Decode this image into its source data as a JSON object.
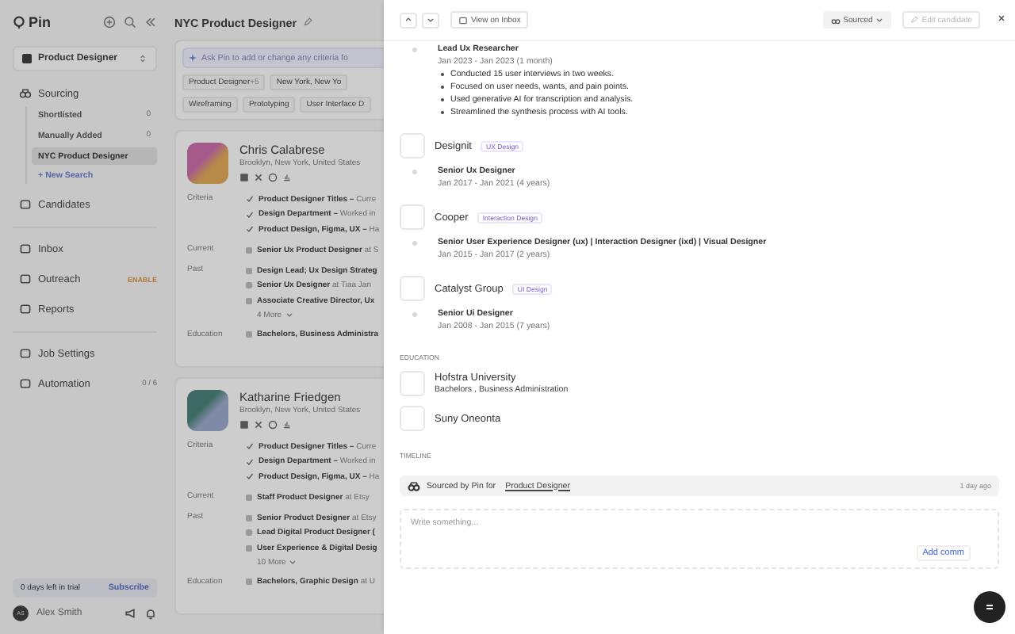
{
  "sidebar": {
    "brand": "Pin",
    "project": "Product Designer",
    "sourcing": {
      "label": "Sourcing",
      "searches": [
        {
          "label": "Shortlisted",
          "count": "0",
          "selected": false
        },
        {
          "label": "Manually Added",
          "count": "0",
          "selected": false
        },
        {
          "label": "NYC Product Designer",
          "selected": true
        }
      ],
      "new_search": "+ New Search"
    },
    "groups": [
      [
        {
          "label": "Candidates"
        }
      ],
      [
        {
          "label": "Inbox"
        },
        {
          "label": "Outreach",
          "badge": "ENABLE"
        },
        {
          "label": "Reports"
        }
      ],
      [
        {
          "label": "Job Settings"
        },
        {
          "label": "Automation",
          "count": "0 / 6"
        }
      ]
    ],
    "trial": {
      "text": "0 days left in trial",
      "action": "Subscribe"
    },
    "user": {
      "initials": "AS",
      "name": "Alex Smith"
    }
  },
  "main": {
    "title": "NYC Product Designer",
    "ask_placeholder": "Ask Pin to add or change any criteria fo",
    "filters": [
      {
        "label": "Product Designer",
        "extra": "+5"
      },
      {
        "label": "New York, New Yo"
      }
    ],
    "skills": [
      "Wireframing",
      "Prototyping",
      "User Interface D"
    ],
    "candidates": [
      {
        "name": "Chris Calabrese",
        "location": "Brooklyn, New York, United States",
        "labels": {
          "criteria": "Criteria",
          "current": "Current",
          "past": "Past",
          "education": "Education"
        },
        "criteria": [
          {
            "title": "Product Designer Titles –",
            "detail": "Curre"
          },
          {
            "title": "Design Department –",
            "detail": "Worked in"
          },
          {
            "title": "Product Design, Figma, UX –",
            "detail": "Ha"
          }
        ],
        "current": [
          {
            "role": "Senior Ux Product Designer",
            "detail": "at S"
          }
        ],
        "past": [
          {
            "role": "Design Lead; Ux Design Strateg"
          },
          {
            "role": "Senior Ux Designer",
            "detail": "at Tiaa  Jan"
          },
          {
            "role": "Associate Creative Director, Ux"
          }
        ],
        "more": "4 More",
        "education": {
          "role": "Bachelors, Business Administra"
        }
      },
      {
        "name": "Katharine Friedgen",
        "location": "Brooklyn, New York, United States",
        "labels": {
          "criteria": "Criteria",
          "current": "Current",
          "past": "Past",
          "education": "Education"
        },
        "criteria": [
          {
            "title": "Product Designer Titles –",
            "detail": "Curre"
          },
          {
            "title": "Design Department –",
            "detail": "Worked in"
          },
          {
            "title": "Product Design, Figma, UX –",
            "detail": "Ha"
          }
        ],
        "current": [
          {
            "role": "Staff Product Designer",
            "detail": "at Etsy"
          }
        ],
        "past": [
          {
            "role": "Senior Product Designer",
            "detail": "at Etsy"
          },
          {
            "role": "Lead Digital Product Designer ("
          },
          {
            "role": "User Experience & Digital Desig"
          }
        ],
        "more": "10 More",
        "education": {
          "role": "Bachelors, Graphic Design",
          "detail": "at U"
        }
      }
    ]
  },
  "drawer": {
    "toolbar": {
      "view_inbox": "View on Inbox",
      "status": "Sourced",
      "edit": {
        "label": "Edit candidate",
        "disabled": true
      }
    },
    "first_role": {
      "title": "Lead Ux Researcher",
      "dates": "Jan 2023 - Jan 2023 (1 month)",
      "bullets": [
        "Conducted 15 user interviews in two weeks.",
        "Focused on user needs, wants, and pain points.",
        "Used generative AI for transcription and analysis.",
        "Streamlined the synthesis process with AI tools."
      ]
    },
    "companies": [
      {
        "name": "Designit",
        "tag": "UX Design",
        "roles": [
          {
            "title": "Senior Ux Designer",
            "dates": "Jan 2017 - Jan 2021 (4 years)"
          }
        ]
      },
      {
        "name": "Cooper",
        "tag": "Interaction Design",
        "roles": [
          {
            "title": "Senior User Experience Designer (ux) | Interaction Designer (ixd) | Visual Designer",
            "dates": "Jan 2015 - Jan 2017 (2 years)"
          }
        ]
      },
      {
        "name": "Catalyst Group",
        "tag": "UI Design",
        "roles": [
          {
            "title": "Senior Ui Designer",
            "dates": "Jan 2008 - Jan 2015 (7 years)"
          }
        ]
      }
    ],
    "education": {
      "heading": "EDUCATION",
      "schools": [
        {
          "name": "Hofstra University",
          "degree": "Bachelors , Business Administration"
        },
        {
          "name": "Suny Oneonta"
        }
      ]
    },
    "timeline": {
      "heading": "TIMELINE",
      "events": [
        {
          "text": "Sourced by Pin for",
          "link": "Product Designer",
          "time": "1 day ago"
        }
      ]
    },
    "comment": {
      "placeholder": "Write something...",
      "action": "Add comm"
    }
  }
}
